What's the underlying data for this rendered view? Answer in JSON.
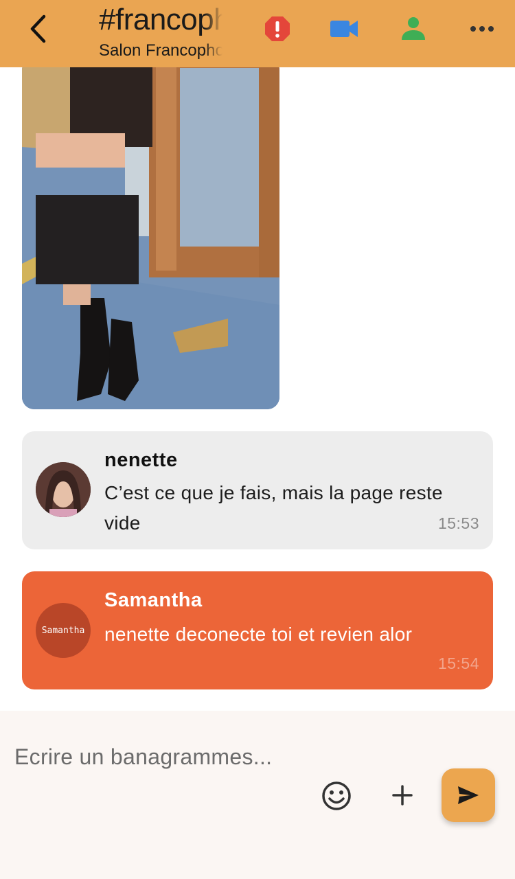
{
  "header": {
    "back_icon": "chevron-left-icon",
    "title": "#francophone",
    "subtitle": "Salon Francophone",
    "icons": [
      "alert-icon",
      "video-camera-icon",
      "user-icon",
      "more-icon"
    ],
    "colors": {
      "background": "#eaa552",
      "alert": "#e4463a",
      "video": "#3a86e0",
      "user": "#3fae55"
    }
  },
  "messages": [
    {
      "sender": "nenette",
      "text": " C’est ce que je fais, mais la page reste vide",
      "time": "15:53",
      "bubble_color": "#ededed"
    },
    {
      "sender": "Samantha",
      "avatar_text": "Samantha",
      "text": "nenette deconecte toi et revien alor",
      "time": "15:54",
      "bubble_color": "#ec6538"
    }
  ],
  "composer": {
    "placeholder": "Ecrire un banagrammes...",
    "icons": [
      "emoji-icon",
      "plus-icon",
      "send-icon"
    ],
    "send_color": "#eca64f"
  }
}
